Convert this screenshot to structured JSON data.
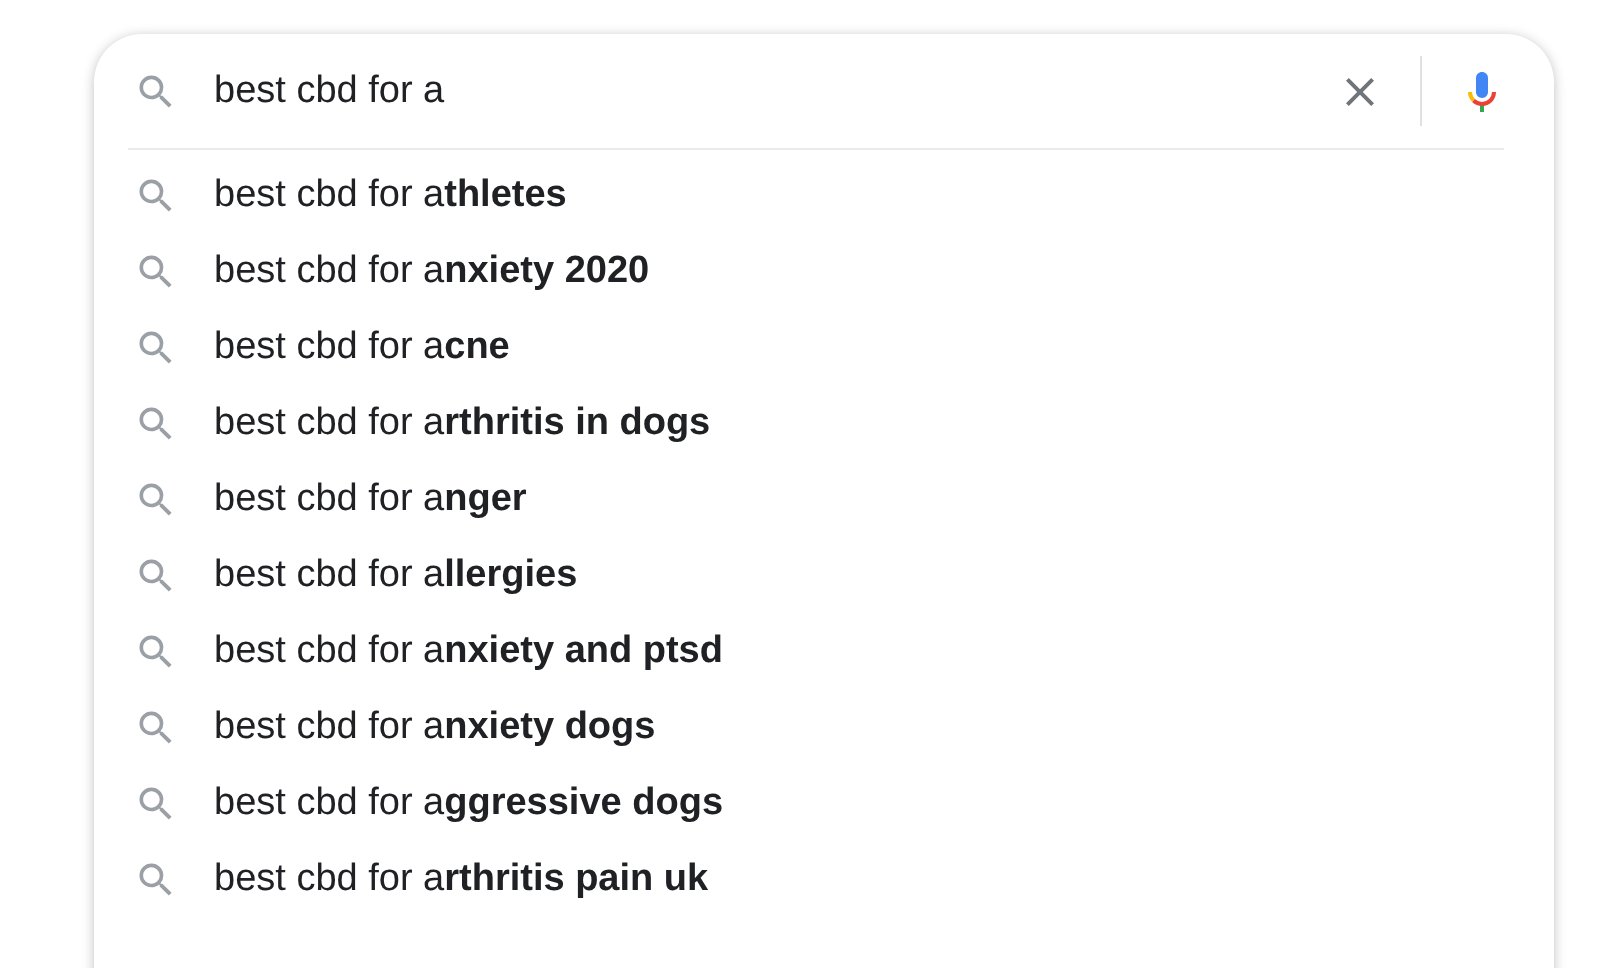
{
  "search": {
    "value": "best cbd for a"
  },
  "suggestions": [
    {
      "text": "best cbd for a**thletes**"
    },
    {
      "text": "best cbd for a**nxiety 2020**"
    },
    {
      "text": "best cbd for a**cne**"
    },
    {
      "text": "best cbd for a**rthritis in dogs**"
    },
    {
      "text": "best cbd for a**nger**"
    },
    {
      "text": "best cbd for a**llergies**"
    },
    {
      "text": "best cbd for a**nxiety and ptsd**"
    },
    {
      "text": "best cbd for a**nxiety dogs**"
    },
    {
      "text": "best cbd for a**ggressive dogs**"
    },
    {
      "text": "best cbd for a**rthritis pain uk**"
    }
  ]
}
